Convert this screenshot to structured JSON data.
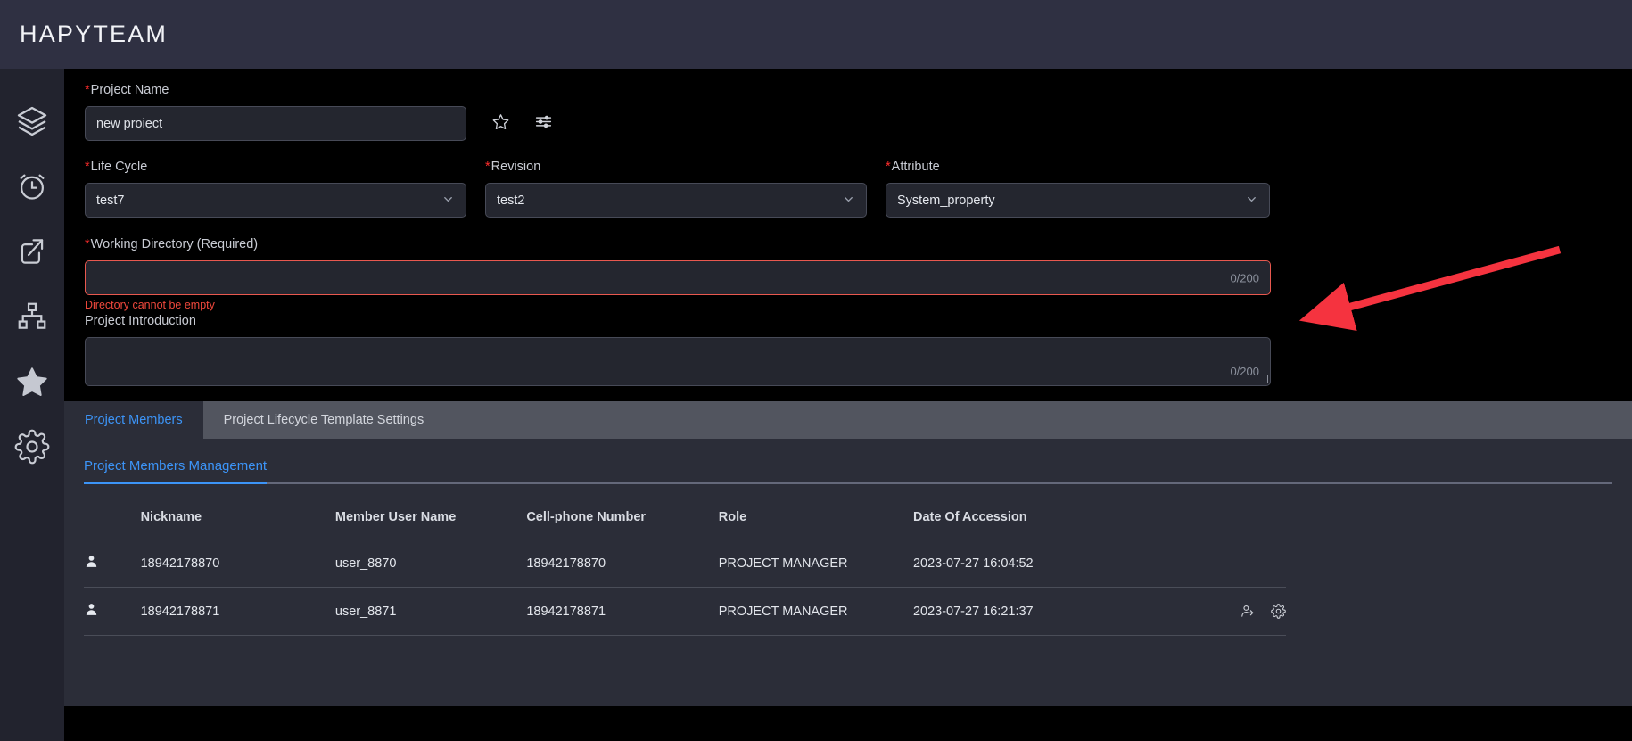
{
  "header": {
    "brand": "HAPYTEAM"
  },
  "sidebar": {
    "items": [
      {
        "name": "layers-icon",
        "label": "Layers"
      },
      {
        "name": "alarm-clock-icon",
        "label": "Schedule"
      },
      {
        "name": "share-export-icon",
        "label": "Export"
      },
      {
        "name": "sitemap-icon",
        "label": "Organization"
      },
      {
        "name": "star-icon",
        "label": "Favorites"
      },
      {
        "name": "gear-icon",
        "label": "Settings"
      }
    ]
  },
  "form": {
    "project_name": {
      "label": "Project Name",
      "required_mark": "*",
      "value": "new proiect",
      "placeholder": ""
    },
    "favorite_icon": "star-outline-icon",
    "settings_icon": "sliders-icon",
    "life_cycle": {
      "label": "Life Cycle",
      "required_mark": "*",
      "value": "test7",
      "chevron": "⌄"
    },
    "revision": {
      "label": "Revision",
      "required_mark": "*",
      "value": "test2",
      "chevron": "⌄"
    },
    "attribute": {
      "label": "Attribute",
      "required_mark": "*",
      "value": "System_property",
      "chevron": "⌄"
    },
    "working_directory": {
      "label": "Working Directory (Required)",
      "required_mark": "*",
      "value": "",
      "counter": "0/200",
      "error": "Directory cannot be empty"
    },
    "project_introduction": {
      "label": "Project Introduction",
      "value": "",
      "counter": "0/200"
    }
  },
  "tabs": [
    {
      "label": "Project Members",
      "active": true
    },
    {
      "label": "Project Lifecycle Template Settings",
      "active": false
    }
  ],
  "panel": {
    "subtab": "Project Members Management",
    "table": {
      "columns": [
        "",
        "Nickname",
        "Member User Name",
        "Cell-phone Number",
        "Role",
        "Date Of Accession",
        ""
      ],
      "rows": [
        {
          "avatar": "user-avatar-icon",
          "nickname": "18942178870",
          "username": "user_8870",
          "phone": "18942178870",
          "role": "PROJECT MANAGER",
          "date": "2023-07-27 16:04:52",
          "actions": []
        },
        {
          "avatar": "user-avatar-icon",
          "nickname": "18942178871",
          "username": "user_8871",
          "phone": "18942178871",
          "role": "PROJECT MANAGER",
          "date": "2023-07-27 16:21:37",
          "actions": [
            "transfer-user-icon",
            "gear-icon"
          ]
        }
      ]
    }
  },
  "annotation": {
    "arrow_color": "#f5333f",
    "description": "red arrow pointing to working directory field"
  },
  "colors": {
    "accent": "#3c94f7",
    "error": "#f0483c",
    "header_bg": "#2f3042",
    "sidebar_bg": "#22232e",
    "panel_bg": "#2b2d38"
  }
}
